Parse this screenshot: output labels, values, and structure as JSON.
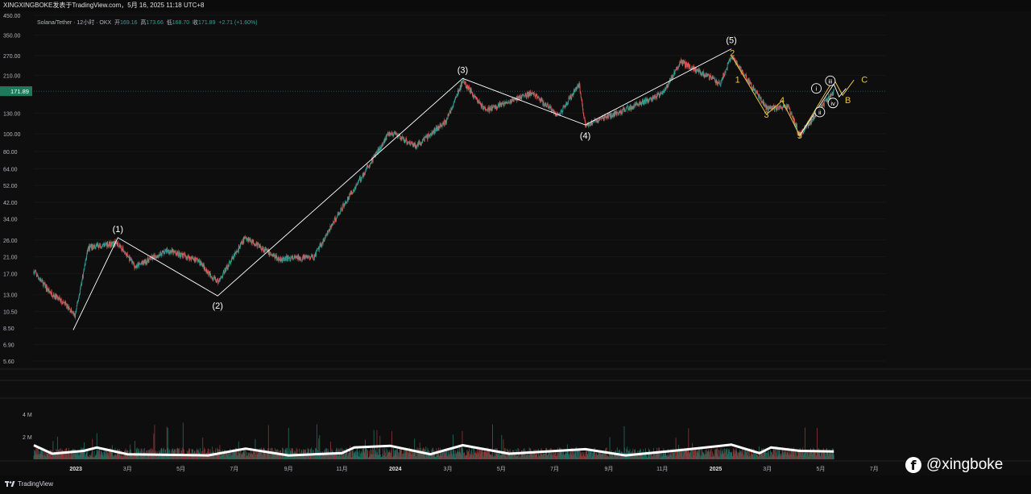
{
  "header": {
    "publish_line": "XINGXINGBOKE发表于TradingView.com，5月 16, 2025 11:18 UTC+8"
  },
  "symbol_info": {
    "name": "Solana/Tether · 12小时 · OKX",
    "open_label": "开",
    "open": "169.16",
    "high_label": "高",
    "high": "173.66",
    "low_label": "低",
    "low": "168.70",
    "close_label": "收",
    "close": "171.89",
    "change": "+2.71 (+1.60%)"
  },
  "price_badge": "171.89",
  "footer": {
    "brand": "TradingView",
    "watermark": "@xingboke",
    "watermark_icon": "facebook-icon"
  },
  "colors": {
    "background": "#0e0e0e",
    "up": "#26a69a",
    "down": "#ef5350",
    "wave_white": "#ffffff",
    "wave_yellow": "#e8c547",
    "volume_ma": "#ffffff"
  },
  "chart_data": [
    {
      "type": "candlestick",
      "title": "Solana/Tether · 12小时 · OKX",
      "y_scale": "log",
      "y_tick_labels": [
        "450.00",
        "350.00",
        "270.00",
        "210.00",
        "130.00",
        "100.00",
        "80.00",
        "64.00",
        "52.00",
        "42.00",
        "34.00",
        "26.00",
        "21.00",
        "17.00",
        "13.00",
        "10.50",
        "8.50",
        "6.90",
        "5.60"
      ],
      "x_tick_labels": [
        "2023",
        "3月",
        "5月",
        "7月",
        "9月",
        "11月",
        "2024",
        "3月",
        "5月",
        "7月",
        "9月",
        "11月",
        "2025",
        "3月",
        "5月",
        "7月"
      ],
      "price_path": [
        {
          "x": "2022-11-14",
          "y": 17.5
        },
        {
          "x": "2022-12-01",
          "y": 13.6
        },
        {
          "x": "2022-12-20",
          "y": 11.5
        },
        {
          "x": "2022-12-31",
          "y": 9.9
        },
        {
          "x": "2023-01-15",
          "y": 23.5
        },
        {
          "x": "2023-02-01",
          "y": 24.6
        },
        {
          "x": "2023-02-18",
          "y": 25.0
        },
        {
          "x": "2023-03-10",
          "y": 18.5
        },
        {
          "x": "2023-04-15",
          "y": 22.8
        },
        {
          "x": "2023-05-20",
          "y": 20.2
        },
        {
          "x": "2023-06-12",
          "y": 15.2
        },
        {
          "x": "2023-07-14",
          "y": 27.0
        },
        {
          "x": "2023-08-20",
          "y": 20.5
        },
        {
          "x": "2023-09-30",
          "y": 20.9
        },
        {
          "x": "2023-10-31",
          "y": 38.5
        },
        {
          "x": "2023-12-05",
          "y": 71.0
        },
        {
          "x": "2023-12-25",
          "y": 102.0
        },
        {
          "x": "2024-01-25",
          "y": 86.0
        },
        {
          "x": "2024-02-28",
          "y": 118.0
        },
        {
          "x": "2024-03-18",
          "y": 195.0
        },
        {
          "x": "2024-04-13",
          "y": 134.0
        },
        {
          "x": "2024-06-05",
          "y": 168.0
        },
        {
          "x": "2024-07-05",
          "y": 126.0
        },
        {
          "x": "2024-07-29",
          "y": 188.0
        },
        {
          "x": "2024-08-05",
          "y": 112.0
        },
        {
          "x": "2024-09-06",
          "y": 128.0
        },
        {
          "x": "2024-11-01",
          "y": 166.0
        },
        {
          "x": "2024-11-22",
          "y": 250.0
        },
        {
          "x": "2025-01-06",
          "y": 190.0
        },
        {
          "x": "2025-01-19",
          "y": 270.0
        },
        {
          "x": "2025-02-28",
          "y": 138.0
        },
        {
          "x": "2025-03-25",
          "y": 140.0
        },
        {
          "x": "2025-04-07",
          "y": 98.0
        },
        {
          "x": "2025-05-16",
          "y": 171.89
        }
      ],
      "wave_labels": {
        "white": [
          {
            "label": "(1)",
            "x": "2023-02-18",
            "y": 26.8
          },
          {
            "label": "(2)",
            "x": "2023-06-12",
            "y": 12.8
          },
          {
            "label": "(3)",
            "x": "2024-03-18",
            "y": 202.0
          },
          {
            "label": "(4)",
            "x": "2024-08-05",
            "y": 112.0
          },
          {
            "label": "(5)",
            "x": "2025-01-19",
            "y": 294.0
          }
        ],
        "white_line": [
          {
            "x": "2022-12-29",
            "y": 8.3
          },
          {
            "x": "2023-02-18",
            "y": 26.8
          },
          {
            "x": "2023-06-12",
            "y": 12.8
          },
          {
            "x": "2024-03-18",
            "y": 202.0
          },
          {
            "x": "2024-08-05",
            "y": 112.0
          },
          {
            "x": "2025-01-19",
            "y": 294.0
          }
        ],
        "yellow": [
          {
            "label": "1",
            "x": "2025-01-26",
            "y": 200.0
          },
          {
            "label": "2",
            "x": "2025-01-20",
            "y": 280.0
          },
          {
            "label": "3",
            "x": "2025-02-28",
            "y": 128.0
          },
          {
            "label": "4",
            "x": "2025-03-18",
            "y": 154.0
          },
          {
            "label": "5",
            "x": "2025-04-07",
            "y": 98.0
          },
          {
            "label": "A",
            "x": "2025-05-14",
            "y": 200.0
          },
          {
            "label": "B",
            "x": "2025-06-01",
            "y": 154.0
          },
          {
            "label": "C",
            "x": "2025-06-20",
            "y": 200.0
          }
        ],
        "yellow_line": [
          {
            "x": "2025-01-19",
            "y": 270.0
          },
          {
            "x": "2025-02-28",
            "y": 128.0
          },
          {
            "x": "2025-03-18",
            "y": 152.0
          },
          {
            "x": "2025-04-07",
            "y": 98.0
          },
          {
            "x": "2025-05-16",
            "y": 200.0
          },
          {
            "x": "2025-05-26",
            "y": 163.0
          },
          {
            "x": "2025-06-08",
            "y": 198.0
          }
        ],
        "sub_white_circled": [
          {
            "label": "i",
            "x": "2025-04-26",
            "y": 178.0
          },
          {
            "label": "ii",
            "x": "2025-04-30",
            "y": 132.0
          },
          {
            "label": "iii",
            "x": "2025-05-12",
            "y": 196.0
          },
          {
            "label": "iv",
            "x": "2025-05-15",
            "y": 148.0
          }
        ],
        "sub_white_line": [
          {
            "x": "2025-04-07",
            "y": 98.0
          },
          {
            "x": "2025-05-16",
            "y": 188.0
          },
          {
            "x": "2025-05-22",
            "y": 160.0
          },
          {
            "x": "2025-05-30",
            "y": 178.0
          }
        ]
      }
    },
    {
      "type": "bar",
      "title": "Volume",
      "y_tick_labels": [
        "4 M",
        "2 M"
      ],
      "series": [
        {
          "name": "Volume MA",
          "type": "line",
          "points": [
            {
              "x": "2022-11-14",
              "y": 1.25
            },
            {
              "x": "2022-12-05",
              "y": 0.5
            },
            {
              "x": "2023-01-10",
              "y": 0.75
            },
            {
              "x": "2023-01-25",
              "y": 1.05
            },
            {
              "x": "2023-03-01",
              "y": 0.45
            },
            {
              "x": "2023-06-01",
              "y": 0.35
            },
            {
              "x": "2023-07-14",
              "y": 0.95
            },
            {
              "x": "2023-09-01",
              "y": 0.35
            },
            {
              "x": "2023-11-01",
              "y": 0.55
            },
            {
              "x": "2023-11-15",
              "y": 1.05
            },
            {
              "x": "2023-12-26",
              "y": 1.2
            },
            {
              "x": "2024-02-10",
              "y": 0.45
            },
            {
              "x": "2024-03-18",
              "y": 1.25
            },
            {
              "x": "2024-05-10",
              "y": 0.5
            },
            {
              "x": "2024-08-05",
              "y": 0.9
            },
            {
              "x": "2024-09-20",
              "y": 0.35
            },
            {
              "x": "2024-11-20",
              "y": 0.8
            },
            {
              "x": "2025-01-19",
              "y": 1.3
            },
            {
              "x": "2025-02-20",
              "y": 0.55
            },
            {
              "x": "2025-03-05",
              "y": 1.05
            },
            {
              "x": "2025-04-07",
              "y": 0.75
            },
            {
              "x": "2025-05-16",
              "y": 0.7
            }
          ]
        }
      ]
    }
  ]
}
